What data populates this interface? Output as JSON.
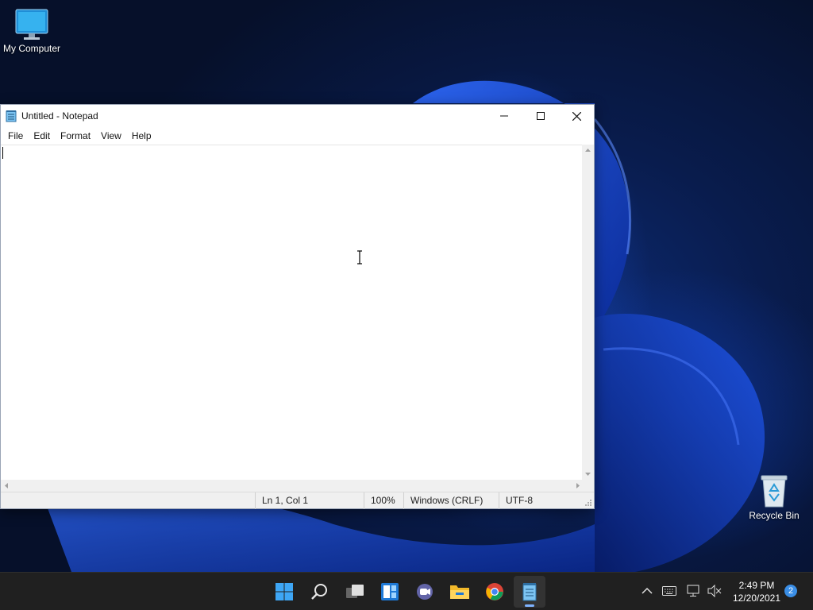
{
  "desktop": {
    "icons": [
      {
        "label": "My Computer",
        "icon": "monitor-icon"
      },
      {
        "label": "Recycle Bin",
        "icon": "recycle-bin-icon"
      }
    ]
  },
  "window": {
    "title": "Untitled - Notepad",
    "controls": [
      "minimize-icon",
      "maximize-icon",
      "close-icon"
    ],
    "menu": [
      "File",
      "Edit",
      "Format",
      "View",
      "Help"
    ],
    "content": "",
    "status": {
      "position": "Ln 1, Col 1",
      "zoom": "100%",
      "line_ending": "Windows (CRLF)",
      "encoding": "UTF-8"
    }
  },
  "taskbar": {
    "apps": [
      "windows-start-icon",
      "search-icon",
      "task-view-icon",
      "widgets-icon",
      "teams-chat-icon",
      "file-explorer-icon",
      "chrome-icon",
      "notepad-icon"
    ],
    "active_app": "notepad-icon",
    "tray": [
      "chevron-up-icon",
      "keyboard-icon",
      "network-icon",
      "volume-muted-icon"
    ],
    "clock": {
      "time": "2:49 PM",
      "date": "12/20/2021"
    },
    "notification_count": "2"
  },
  "colors": {
    "taskbar": "#202020",
    "accent": "#3a8ee6",
    "wallpaper_dark": "#06102a",
    "wallpaper_blue": "#1e5ae6"
  }
}
